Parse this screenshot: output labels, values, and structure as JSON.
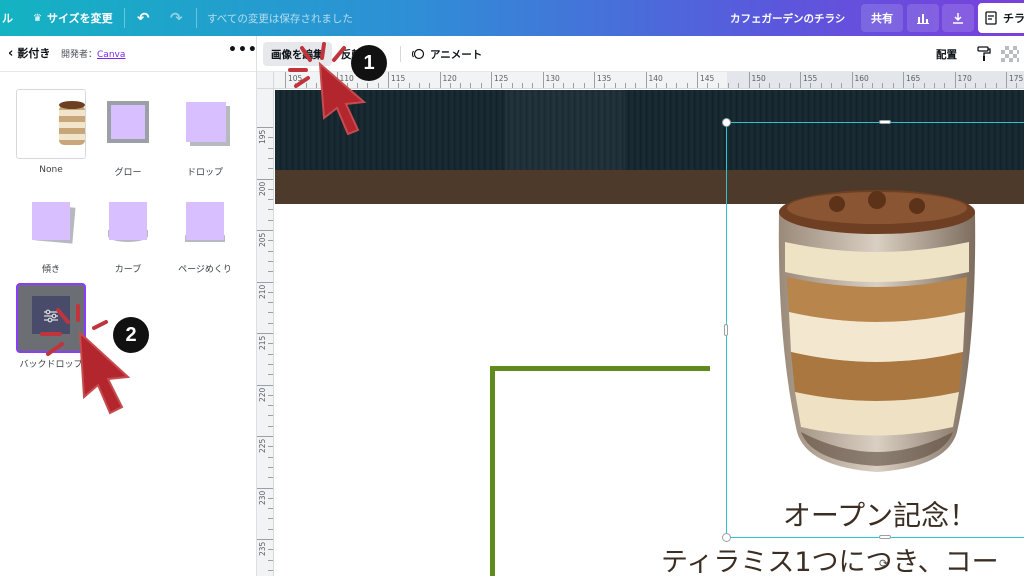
{
  "topbar": {
    "file_fragment": "ル",
    "resize_label": "サイズを変更",
    "saved_status": "すべての変更は保存されました",
    "doc_title": "カフェガーデンのチラシ",
    "share_label": "共有",
    "print_label": "チラ"
  },
  "panel": {
    "back_title": "影付き",
    "developer_prefix": "開発者：",
    "developer_name": "Canva",
    "more_label": "•••",
    "effects": [
      {
        "label": "None"
      },
      {
        "label": "グロー"
      },
      {
        "label": "ドロップ"
      },
      {
        "label": "傾き"
      },
      {
        "label": "カーブ"
      },
      {
        "label": "ページめくり"
      },
      {
        "label": "バックドロップ"
      }
    ]
  },
  "toolbar": {
    "edit_image_label": "画像を編集",
    "flip_label": "反転",
    "animate_label": "アニメート",
    "position_label": "配置"
  },
  "ruler": {
    "top_ticks": [
      "105",
      "110",
      "115",
      "120",
      "125",
      "130",
      "135",
      "140",
      "145",
      "150",
      "155",
      "160",
      "165",
      "170",
      "175"
    ],
    "left_ticks": [
      "195",
      "200",
      "205",
      "210",
      "215",
      "220",
      "225",
      "230",
      "235"
    ]
  },
  "canvas": {
    "promo_line1": "オープン記念！",
    "promo_line2": "ティラミス1つにつき、コー"
  },
  "annotations": {
    "step1": "1",
    "step2": "2"
  },
  "colors": {
    "accent_purple": "#7d2ae8",
    "selection_cyan": "#2fc3cf",
    "frame_green": "#5f8a1d",
    "annotation_red": "#b3262d"
  }
}
